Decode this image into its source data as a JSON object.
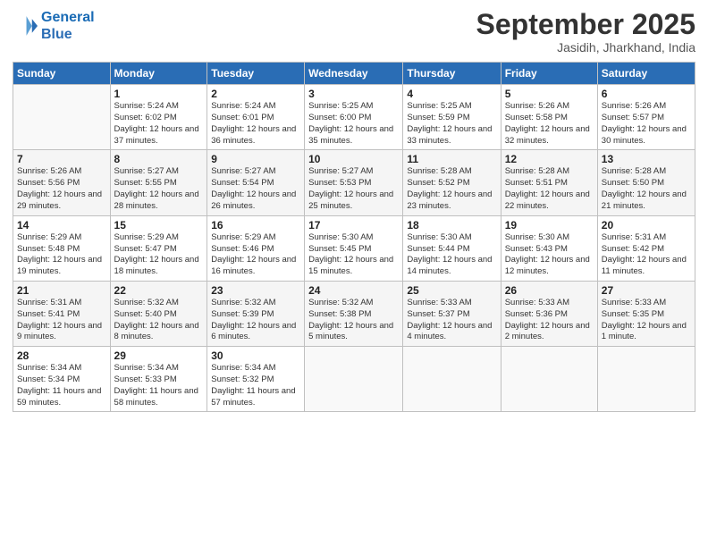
{
  "header": {
    "logo_line1": "General",
    "logo_line2": "Blue",
    "month": "September 2025",
    "location": "Jasidih, Jharkhand, India"
  },
  "days_of_week": [
    "Sunday",
    "Monday",
    "Tuesday",
    "Wednesday",
    "Thursday",
    "Friday",
    "Saturday"
  ],
  "weeks": [
    [
      {
        "day": "",
        "sunrise": "",
        "sunset": "",
        "daylight": ""
      },
      {
        "day": "1",
        "sunrise": "Sunrise: 5:24 AM",
        "sunset": "Sunset: 6:02 PM",
        "daylight": "Daylight: 12 hours and 37 minutes."
      },
      {
        "day": "2",
        "sunrise": "Sunrise: 5:24 AM",
        "sunset": "Sunset: 6:01 PM",
        "daylight": "Daylight: 12 hours and 36 minutes."
      },
      {
        "day": "3",
        "sunrise": "Sunrise: 5:25 AM",
        "sunset": "Sunset: 6:00 PM",
        "daylight": "Daylight: 12 hours and 35 minutes."
      },
      {
        "day": "4",
        "sunrise": "Sunrise: 5:25 AM",
        "sunset": "Sunset: 5:59 PM",
        "daylight": "Daylight: 12 hours and 33 minutes."
      },
      {
        "day": "5",
        "sunrise": "Sunrise: 5:26 AM",
        "sunset": "Sunset: 5:58 PM",
        "daylight": "Daylight: 12 hours and 32 minutes."
      },
      {
        "day": "6",
        "sunrise": "Sunrise: 5:26 AM",
        "sunset": "Sunset: 5:57 PM",
        "daylight": "Daylight: 12 hours and 30 minutes."
      }
    ],
    [
      {
        "day": "7",
        "sunrise": "Sunrise: 5:26 AM",
        "sunset": "Sunset: 5:56 PM",
        "daylight": "Daylight: 12 hours and 29 minutes."
      },
      {
        "day": "8",
        "sunrise": "Sunrise: 5:27 AM",
        "sunset": "Sunset: 5:55 PM",
        "daylight": "Daylight: 12 hours and 28 minutes."
      },
      {
        "day": "9",
        "sunrise": "Sunrise: 5:27 AM",
        "sunset": "Sunset: 5:54 PM",
        "daylight": "Daylight: 12 hours and 26 minutes."
      },
      {
        "day": "10",
        "sunrise": "Sunrise: 5:27 AM",
        "sunset": "Sunset: 5:53 PM",
        "daylight": "Daylight: 12 hours and 25 minutes."
      },
      {
        "day": "11",
        "sunrise": "Sunrise: 5:28 AM",
        "sunset": "Sunset: 5:52 PM",
        "daylight": "Daylight: 12 hours and 23 minutes."
      },
      {
        "day": "12",
        "sunrise": "Sunrise: 5:28 AM",
        "sunset": "Sunset: 5:51 PM",
        "daylight": "Daylight: 12 hours and 22 minutes."
      },
      {
        "day": "13",
        "sunrise": "Sunrise: 5:28 AM",
        "sunset": "Sunset: 5:50 PM",
        "daylight": "Daylight: 12 hours and 21 minutes."
      }
    ],
    [
      {
        "day": "14",
        "sunrise": "Sunrise: 5:29 AM",
        "sunset": "Sunset: 5:48 PM",
        "daylight": "Daylight: 12 hours and 19 minutes."
      },
      {
        "day": "15",
        "sunrise": "Sunrise: 5:29 AM",
        "sunset": "Sunset: 5:47 PM",
        "daylight": "Daylight: 12 hours and 18 minutes."
      },
      {
        "day": "16",
        "sunrise": "Sunrise: 5:29 AM",
        "sunset": "Sunset: 5:46 PM",
        "daylight": "Daylight: 12 hours and 16 minutes."
      },
      {
        "day": "17",
        "sunrise": "Sunrise: 5:30 AM",
        "sunset": "Sunset: 5:45 PM",
        "daylight": "Daylight: 12 hours and 15 minutes."
      },
      {
        "day": "18",
        "sunrise": "Sunrise: 5:30 AM",
        "sunset": "Sunset: 5:44 PM",
        "daylight": "Daylight: 12 hours and 14 minutes."
      },
      {
        "day": "19",
        "sunrise": "Sunrise: 5:30 AM",
        "sunset": "Sunset: 5:43 PM",
        "daylight": "Daylight: 12 hours and 12 minutes."
      },
      {
        "day": "20",
        "sunrise": "Sunrise: 5:31 AM",
        "sunset": "Sunset: 5:42 PM",
        "daylight": "Daylight: 12 hours and 11 minutes."
      }
    ],
    [
      {
        "day": "21",
        "sunrise": "Sunrise: 5:31 AM",
        "sunset": "Sunset: 5:41 PM",
        "daylight": "Daylight: 12 hours and 9 minutes."
      },
      {
        "day": "22",
        "sunrise": "Sunrise: 5:32 AM",
        "sunset": "Sunset: 5:40 PM",
        "daylight": "Daylight: 12 hours and 8 minutes."
      },
      {
        "day": "23",
        "sunrise": "Sunrise: 5:32 AM",
        "sunset": "Sunset: 5:39 PM",
        "daylight": "Daylight: 12 hours and 6 minutes."
      },
      {
        "day": "24",
        "sunrise": "Sunrise: 5:32 AM",
        "sunset": "Sunset: 5:38 PM",
        "daylight": "Daylight: 12 hours and 5 minutes."
      },
      {
        "day": "25",
        "sunrise": "Sunrise: 5:33 AM",
        "sunset": "Sunset: 5:37 PM",
        "daylight": "Daylight: 12 hours and 4 minutes."
      },
      {
        "day": "26",
        "sunrise": "Sunrise: 5:33 AM",
        "sunset": "Sunset: 5:36 PM",
        "daylight": "Daylight: 12 hours and 2 minutes."
      },
      {
        "day": "27",
        "sunrise": "Sunrise: 5:33 AM",
        "sunset": "Sunset: 5:35 PM",
        "daylight": "Daylight: 12 hours and 1 minute."
      }
    ],
    [
      {
        "day": "28",
        "sunrise": "Sunrise: 5:34 AM",
        "sunset": "Sunset: 5:34 PM",
        "daylight": "Daylight: 11 hours and 59 minutes."
      },
      {
        "day": "29",
        "sunrise": "Sunrise: 5:34 AM",
        "sunset": "Sunset: 5:33 PM",
        "daylight": "Daylight: 11 hours and 58 minutes."
      },
      {
        "day": "30",
        "sunrise": "Sunrise: 5:34 AM",
        "sunset": "Sunset: 5:32 PM",
        "daylight": "Daylight: 11 hours and 57 minutes."
      },
      {
        "day": "",
        "sunrise": "",
        "sunset": "",
        "daylight": ""
      },
      {
        "day": "",
        "sunrise": "",
        "sunset": "",
        "daylight": ""
      },
      {
        "day": "",
        "sunrise": "",
        "sunset": "",
        "daylight": ""
      },
      {
        "day": "",
        "sunrise": "",
        "sunset": "",
        "daylight": ""
      }
    ]
  ]
}
